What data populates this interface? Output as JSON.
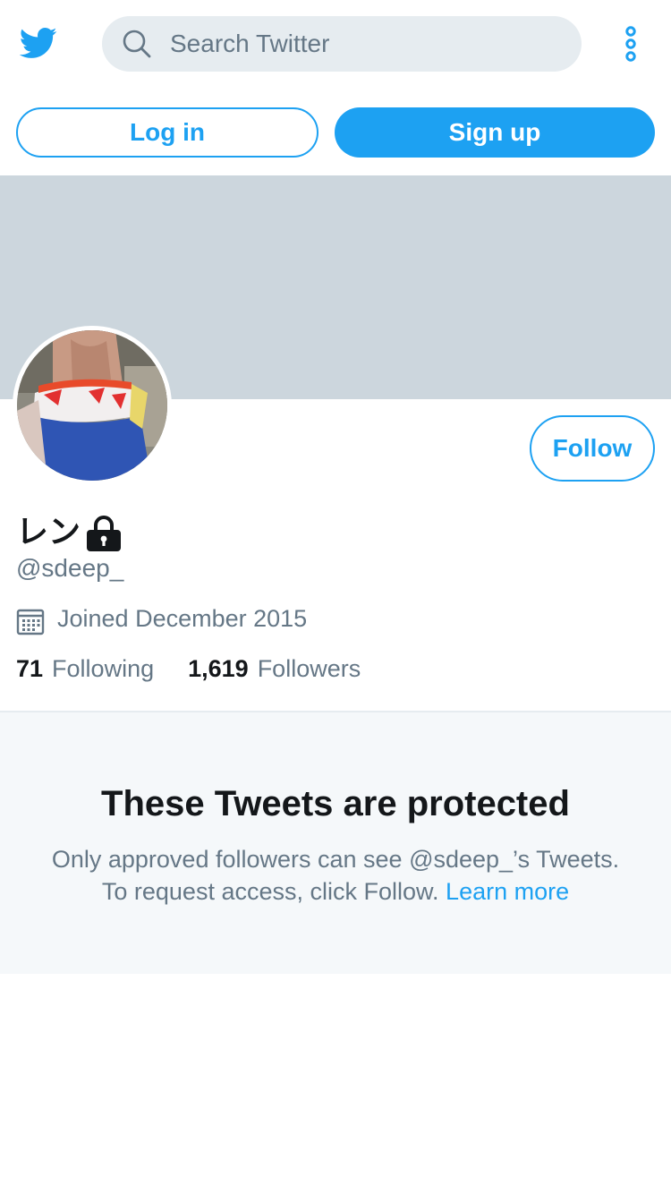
{
  "colors": {
    "accent": "#1da1f2",
    "banner": "#ccd6dd",
    "muted_text": "#657786",
    "search_bg": "#e6ecf0",
    "protected_bg": "#f5f8fa"
  },
  "header": {
    "logo_icon": "twitter-bird-icon",
    "search": {
      "icon": "search-icon",
      "placeholder": "Search Twitter"
    },
    "more_icon": "more-vertical-icon"
  },
  "auth": {
    "login_label": "Log in",
    "signup_label": "Sign up"
  },
  "profile": {
    "display_name": "レン",
    "protected_icon": "lock-icon",
    "handle": "@sdeep_",
    "joined_icon": "calendar-icon",
    "joined": "Joined December 2015",
    "follow_label": "Follow",
    "following_count": "71",
    "following_label": "Following",
    "followers_count": "1,619",
    "followers_label": "Followers"
  },
  "protected_notice": {
    "title": "These Tweets are protected",
    "line1": "Only approved followers can see @sdeep_’s Tweets.",
    "line2": "To request access, click Follow.",
    "learn_more": "Learn more"
  }
}
